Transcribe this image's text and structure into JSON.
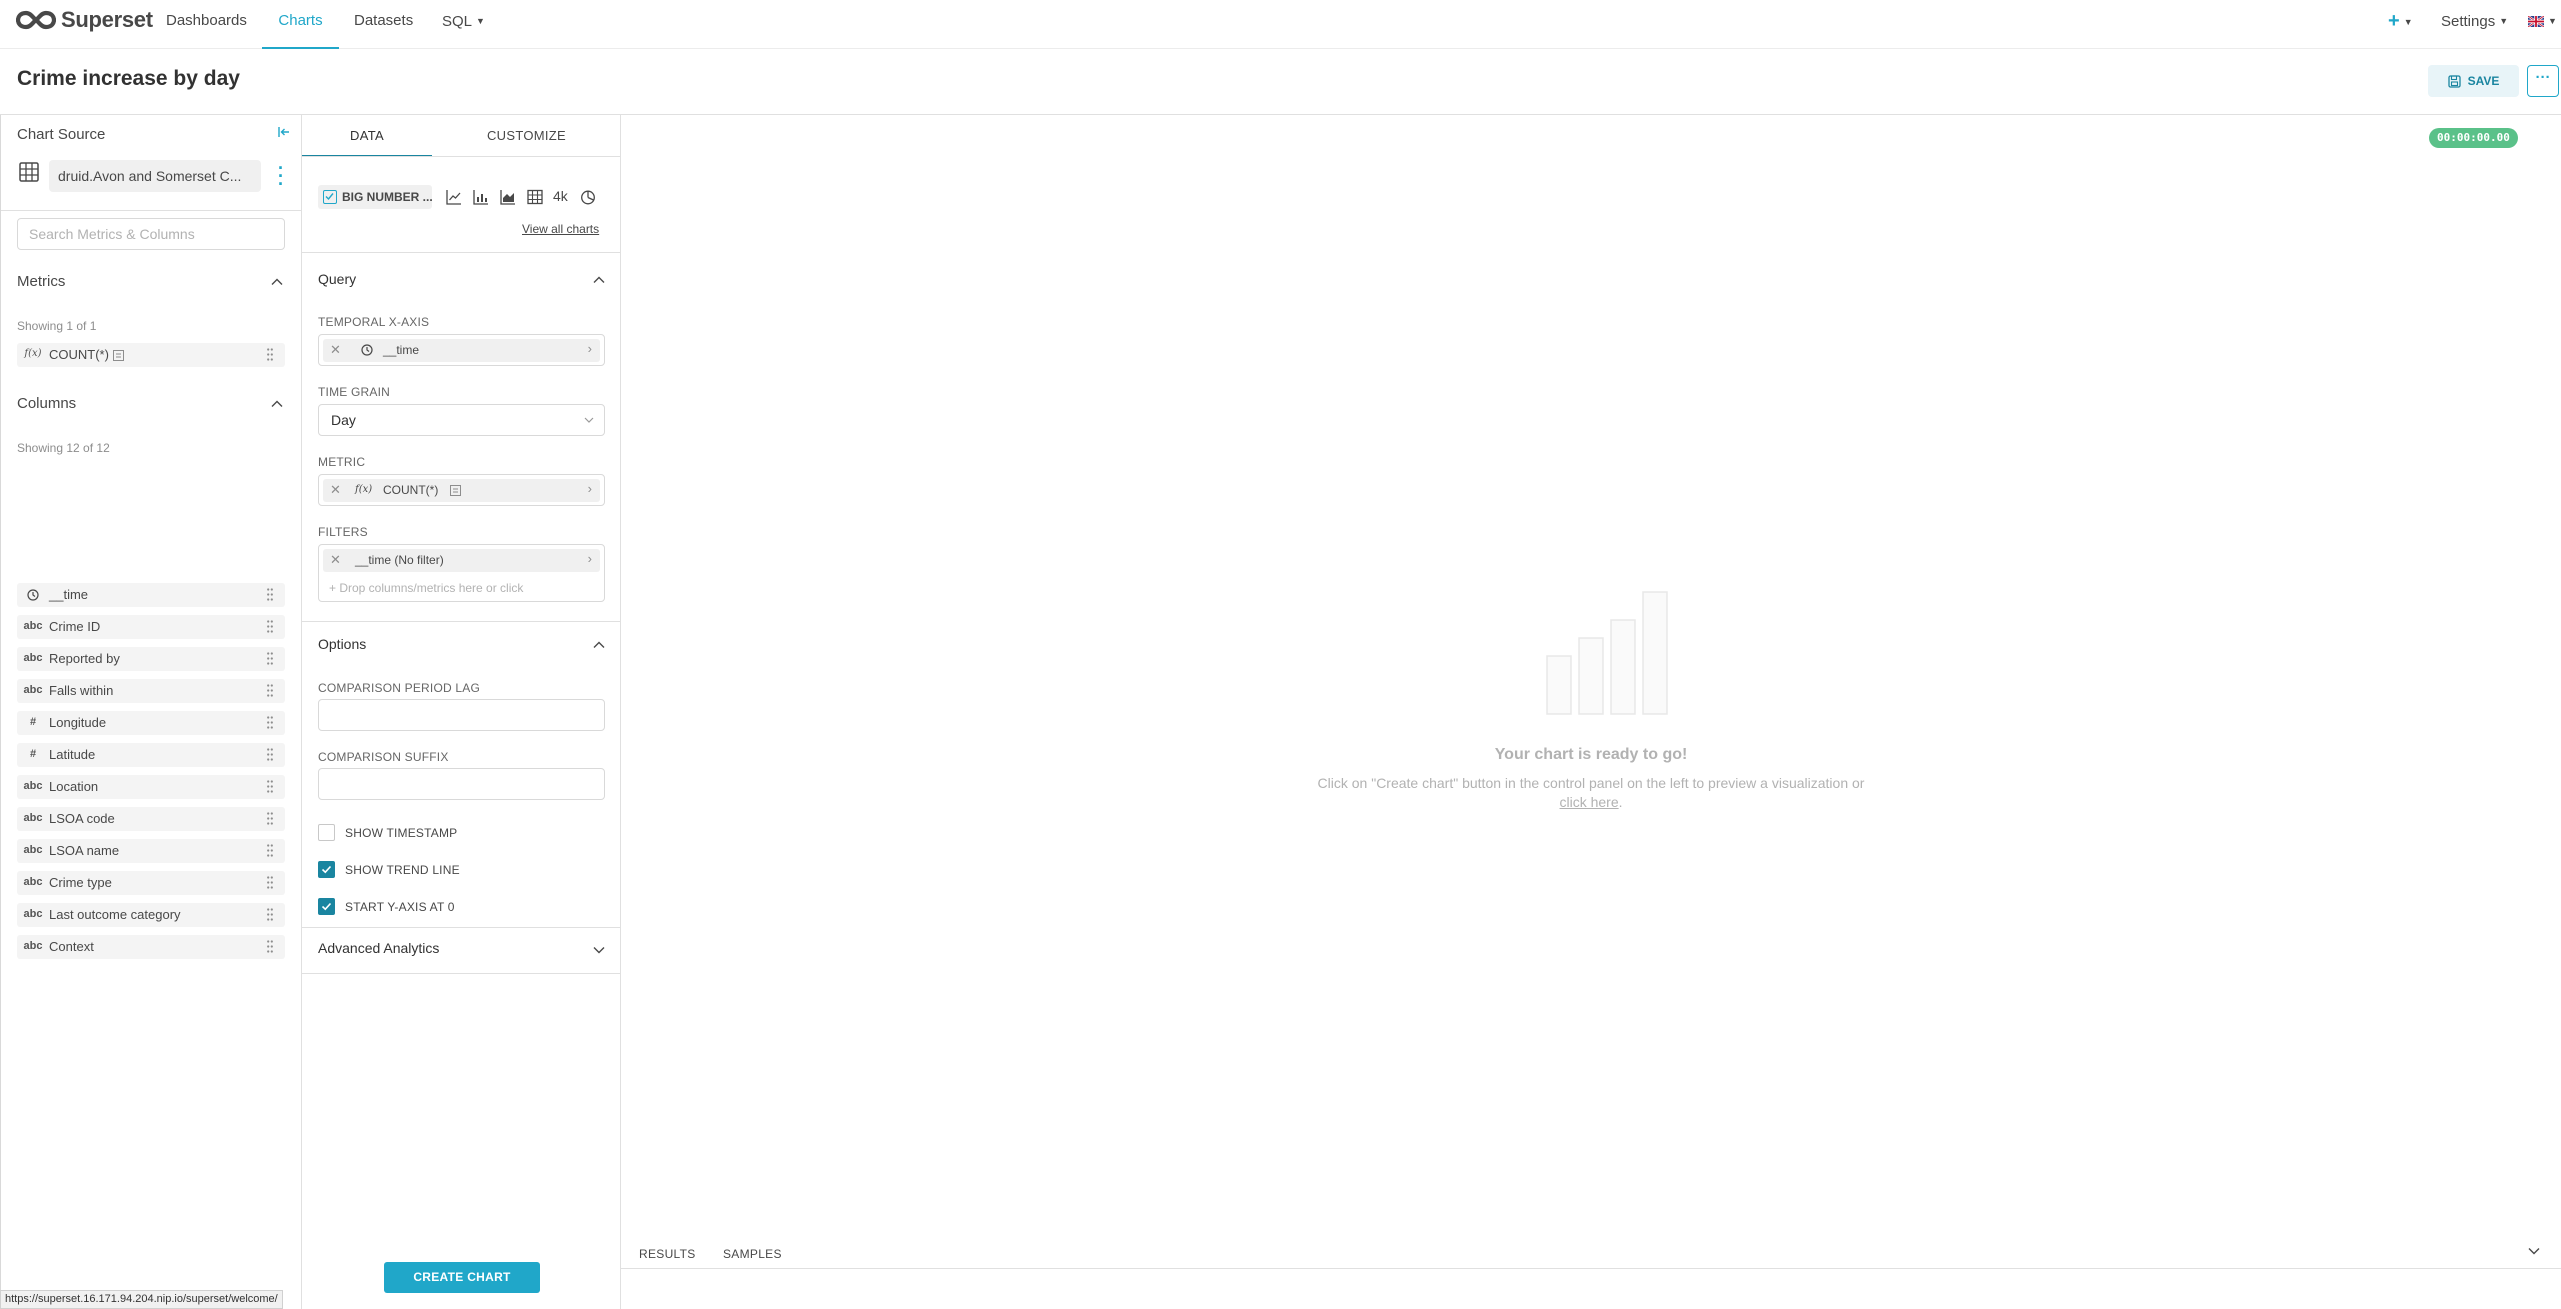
{
  "navbar": {
    "brand": "Superset",
    "items": [
      {
        "label": "Dashboards"
      },
      {
        "label": "Charts"
      },
      {
        "label": "Datasets"
      },
      {
        "label": "SQL"
      }
    ],
    "plus_label": "+",
    "settings_label": "Settings",
    "accent_color": "#20a7c9"
  },
  "header": {
    "title": "Crime increase by day",
    "save_label": "SAVE",
    "more_label": "···"
  },
  "datasource": {
    "title": "Chart Source",
    "name": "druid.Avon and Somerset C...",
    "search_placeholder": "Search Metrics & Columns",
    "metrics_title": "Metrics",
    "metrics_showing": "Showing 1 of 1",
    "metrics": [
      {
        "type": "f(x)",
        "label": "COUNT(*)"
      }
    ],
    "columns_title": "Columns",
    "columns_showing": "Showing 12 of 12",
    "columns": [
      {
        "type": "clock",
        "label": "__time"
      },
      {
        "type": "abc",
        "label": "Crime ID"
      },
      {
        "type": "abc",
        "label": "Reported by"
      },
      {
        "type": "abc",
        "label": "Falls within"
      },
      {
        "type": "#",
        "label": "Longitude"
      },
      {
        "type": "#",
        "label": "Latitude"
      },
      {
        "type": "abc",
        "label": "Location"
      },
      {
        "type": "abc",
        "label": "LSOA code"
      },
      {
        "type": "abc",
        "label": "LSOA name"
      },
      {
        "type": "abc",
        "label": "Crime type"
      },
      {
        "type": "abc",
        "label": "Last outcome category"
      },
      {
        "type": "abc",
        "label": "Context"
      }
    ]
  },
  "control_panel": {
    "tabs": [
      {
        "label": "DATA"
      },
      {
        "label": "CUSTOMIZE"
      }
    ],
    "viz_selected": "BIG NUMBER ...",
    "viz_4k_label": "4k",
    "view_all": "View all charts",
    "query": {
      "title": "Query",
      "temporal_label": "TEMPORAL X-AXIS",
      "temporal_value": "__time",
      "time_grain_label": "TIME GRAIN",
      "time_grain_value": "Day",
      "metric_label": "METRIC",
      "metric_prefix": "f(x)",
      "metric_value": "COUNT(*)",
      "filters_label": "FILTERS",
      "filter_value": "__time (No filter)",
      "filter_drop_hint": "+ Drop columns/metrics here or click"
    },
    "options": {
      "title": "Options",
      "lag_label": "COMPARISON PERIOD LAG",
      "suffix_label": "COMPARISON SUFFIX",
      "show_timestamp_label": "SHOW TIMESTAMP",
      "show_timestamp_checked": false,
      "show_trend_label": "SHOW TREND LINE",
      "show_trend_checked": true,
      "start_y_label": "START Y-AXIS AT 0",
      "start_y_checked": true
    },
    "advanced_title": "Advanced Analytics",
    "create_label": "CREATE CHART"
  },
  "main": {
    "timer": "00:00:00.00",
    "timer_color": "#5ac189",
    "empty_title": "Your chart is ready to go!",
    "empty_desc": "Click on \"Create chart\" button in the control panel on the left to preview a visualization or",
    "empty_link": "click here",
    "empty_link_suffix": ".",
    "bottom_tabs": [
      {
        "label": "RESULTS"
      },
      {
        "label": "SAMPLES"
      }
    ]
  },
  "status_bar": {
    "url": "https://superset.16.171.94.204.nip.io/superset/welcome/"
  }
}
